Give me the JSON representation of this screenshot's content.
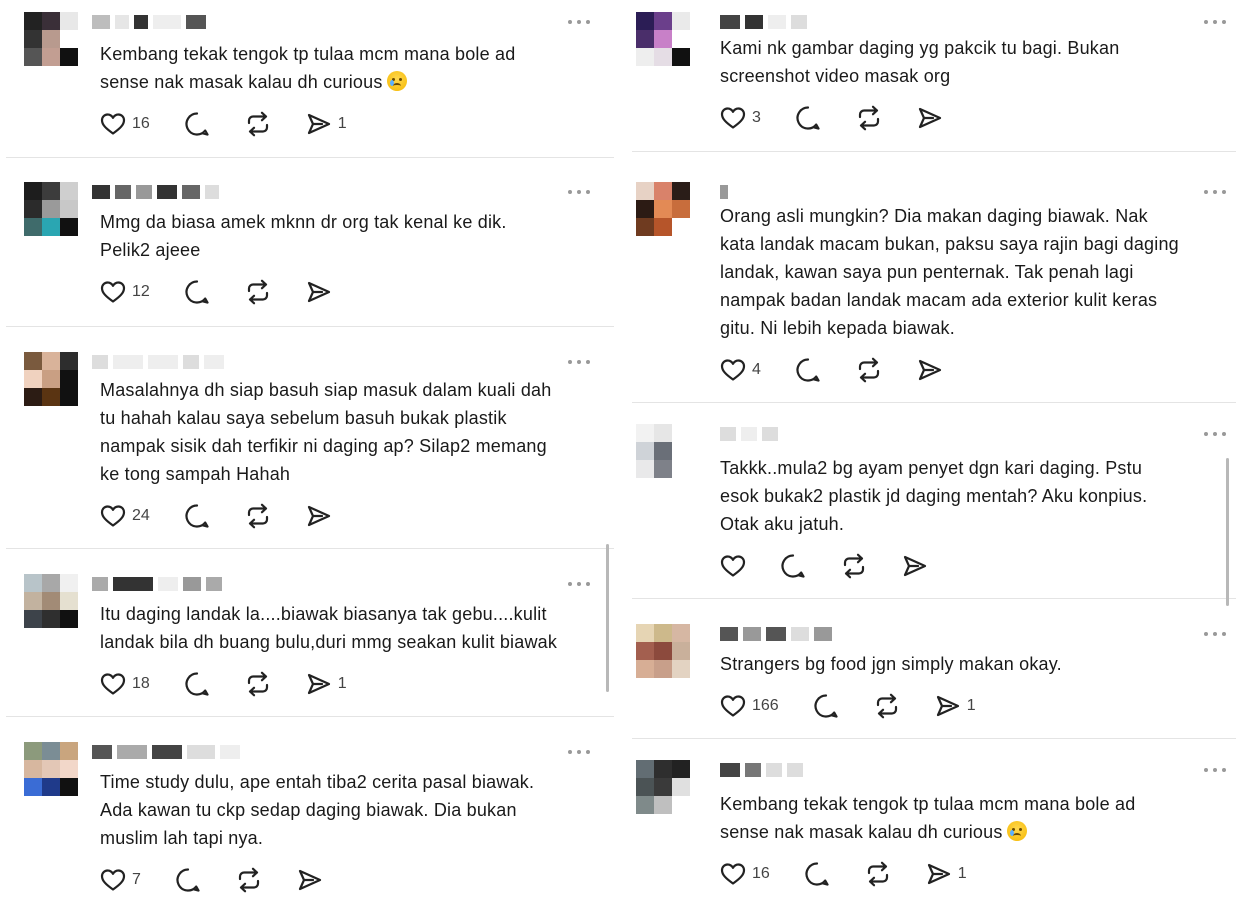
{
  "colors": {
    "text": "#1a1a1a",
    "muted": "#444444",
    "divider": "#e4e4e4",
    "scrollbar": "#b8b8b8"
  },
  "icons": {
    "like": "heart-icon",
    "reply": "comment-icon",
    "repost": "repost-icon",
    "share": "send-icon",
    "more": "more-icon"
  },
  "left_column": {
    "posts": [
      {
        "lines": [
          "Kembang tekak tengok tp tulaa mcm mana bole ad",
          "sense nak masak kalau dh curious"
        ],
        "emoji": "crying-emoji",
        "likes": "16",
        "shares": "1"
      },
      {
        "lines": [
          "Mmg da biasa amek mknn dr org tak kenal ke dik.",
          "Pelik2 ajeee"
        ],
        "likes": "12",
        "shares": ""
      },
      {
        "lines": [
          "Masalahnya dh siap basuh siap masuk dalam kuali dah",
          "tu hahah kalau saya sebelum basuh bukak plastik",
          "nampak sisik dah terfikir ni daging ap? Silap2 memang",
          "ke tong sampah Hahah"
        ],
        "likes": "24",
        "shares": ""
      },
      {
        "lines": [
          "Itu daging landak la....biawak biasanya tak gebu....kulit",
          "landak bila dh buang bulu,duri mmg seakan kulit biawak"
        ],
        "likes": "18",
        "shares": "1"
      },
      {
        "lines": [
          "Time study dulu, ape entah tiba2 cerita pasal biawak.",
          "Ada kawan tu ckp sedap daging biawak. Dia bukan",
          "muslim lah tapi nya."
        ],
        "likes": "7",
        "shares": ""
      }
    ]
  },
  "right_column": {
    "posts": [
      {
        "lines": [
          "Kami nk gambar daging yg pakcik tu bagi. Bukan",
          "screenshot video masak org"
        ],
        "likes": "3",
        "shares": ""
      },
      {
        "lines": [
          "Orang asli mungkin? Dia makan daging biawak. Nak",
          "kata landak macam bukan, paksu saya rajin bagi daging",
          "landak, kawan saya pun penternak. Tak penah lagi",
          "nampak badan landak macam ada exterior kulit keras",
          "gitu. Ni lebih kepada biawak."
        ],
        "likes": "4",
        "shares": ""
      },
      {
        "lines": [
          "Takkk..mula2 bg ayam penyet dgn kari daging. Pstu",
          "esok bukak2 plastik jd daging mentah? Aku konpius.",
          "Otak aku jatuh."
        ],
        "likes": "",
        "shares": ""
      },
      {
        "lines": [
          "Strangers bg food jgn simply makan okay."
        ],
        "likes": "166",
        "shares": "1"
      },
      {
        "lines": [
          "Kembang tekak tengok tp tulaa mcm mana bole ad",
          "sense nak masak kalau dh curious"
        ],
        "emoji": "crying-emoji",
        "likes": "16",
        "shares": "1"
      }
    ]
  }
}
